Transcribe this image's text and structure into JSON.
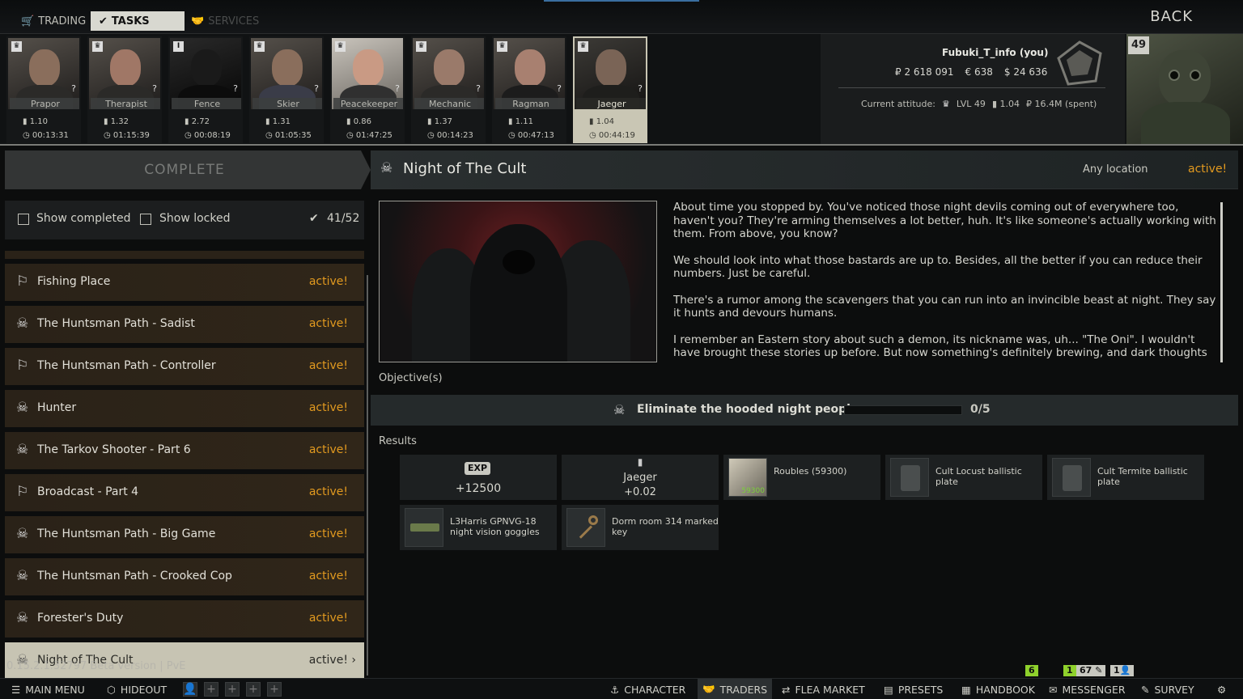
{
  "nav": {
    "tabs": [
      {
        "label": "TRADING",
        "icon": "cart-icon"
      },
      {
        "label": "TASKS",
        "icon": "check-icon"
      },
      {
        "label": "SERVICES",
        "icon": "handshake-icon"
      }
    ],
    "back_label": "BACK"
  },
  "traders": [
    {
      "name": "Prapor",
      "badge": "crown",
      "standing": "1.10",
      "time": "00:13:31",
      "selected": false
    },
    {
      "name": "Therapist",
      "badge": "crown",
      "standing": "1.32",
      "time": "01:15:39",
      "selected": false
    },
    {
      "name": "Fence",
      "badge": "I",
      "standing": "2.72",
      "time": "00:08:19",
      "selected": false
    },
    {
      "name": "Skier",
      "badge": "crown",
      "standing": "1.31",
      "time": "01:05:35",
      "selected": false
    },
    {
      "name": "Peacekeeper",
      "badge": "crown",
      "standing": "0.86",
      "time": "01:47:25",
      "selected": false
    },
    {
      "name": "Mechanic",
      "badge": "crown",
      "standing": "1.37",
      "time": "00:14:23",
      "selected": false
    },
    {
      "name": "Ragman",
      "badge": "crown",
      "standing": "1.11",
      "time": "00:47:13",
      "selected": false
    },
    {
      "name": "Jaeger",
      "badge": "crown",
      "standing": "1.04",
      "time": "00:44:19",
      "selected": true
    }
  ],
  "player": {
    "name": "Fubuki_T_info (you)",
    "roubles": "₽ 2 618 091",
    "euros": "€ 638",
    "dollars": "$ 24 636",
    "attitude_label": "Current attitude:",
    "attitude_level": "LVL 49",
    "attitude_standing": "1.04",
    "attitude_spent": "₽ 16.4M (spent)",
    "level": "49"
  },
  "left": {
    "complete_label": "COMPLETE",
    "show_completed": "Show completed",
    "show_locked": "Show locked",
    "progress": "41/52"
  },
  "tasks": [
    {
      "name": "Fishing Place",
      "status": "active!",
      "icon": "exit-icon"
    },
    {
      "name": "The Huntsman Path - Sadist",
      "status": "active!",
      "icon": "skull-icon"
    },
    {
      "name": "The Huntsman Path - Controller",
      "status": "active!",
      "icon": "exit-icon"
    },
    {
      "name": "Hunter",
      "status": "active!",
      "icon": "skull-icon"
    },
    {
      "name": "The Tarkov Shooter - Part 6",
      "status": "active!",
      "icon": "skull-icon"
    },
    {
      "name": "Broadcast - Part 4",
      "status": "active!",
      "icon": "exit-icon"
    },
    {
      "name": "The Huntsman Path - Big Game",
      "status": "active!",
      "icon": "skull-icon"
    },
    {
      "name": "The Huntsman Path - Crooked Cop",
      "status": "active!",
      "icon": "skull-icon"
    },
    {
      "name": "Forester's Duty",
      "status": "active!",
      "icon": "skull-icon"
    },
    {
      "name": "Night of The Cult",
      "status": "active!",
      "icon": "skull-icon",
      "selected": true
    }
  ],
  "version": "0.15.2.1.32797 Beta version | PvE",
  "quest": {
    "title": "Night of The Cult",
    "location": "Any location",
    "status": "active!",
    "description": [
      "About time you stopped by. You've noticed those night devils coming out of everywhere too, haven't you? They're arming themselves a lot better, huh. It's like someone's actually working with them. From above, you know?",
      "We should look into what those bastards are up to. Besides, all the better if you can reduce their numbers. Just be careful.",
      "There's a rumor among the scavengers that you can run into an invincible beast at night. They say it hunts and devours humans.",
      "I remember an Eastern story about such a demon, its nickname was, uh... \"The Oni\". I wouldn't have brought these stories up before. But now something's definitely brewing, and dark thoughts just"
    ],
    "objectives_label": "Objective(s)",
    "objective": {
      "text": "Eliminate the hooded night people",
      "count": "0/5",
      "progress": 0
    },
    "results_label": "Results",
    "rewards": {
      "exp_badge": "EXP",
      "exp_value": "+12500",
      "trader_name": "Jaeger",
      "trader_value": "+0.02",
      "items": [
        {
          "name": "Roubles (59300)",
          "qty": "59300"
        },
        {
          "name": "Cult Locust ballistic plate"
        },
        {
          "name": "Cult Termite ballistic plate"
        },
        {
          "name": "L3Harris GPNVG-18 night vision goggles"
        },
        {
          "name": "Dorm room 314 marked key"
        }
      ]
    }
  },
  "bottom": {
    "main_menu": "MAIN MENU",
    "hideout": "HIDEOUT",
    "character": "CHARACTER",
    "traders": "TRADERS",
    "flea_market": "FLEA MARKET",
    "presets": "PRESETS",
    "handbook": "HANDBOOK",
    "messenger": "MESSENGER",
    "survey": "SURVEY",
    "badge_flea": "6",
    "badge_msg_new": "1",
    "badge_msg_count": "67",
    "badge_friends": "1"
  },
  "colors": {
    "active_status": "#e29a1f",
    "selected_row": "#c7c4b3",
    "badge_green": "#8fd12c"
  }
}
